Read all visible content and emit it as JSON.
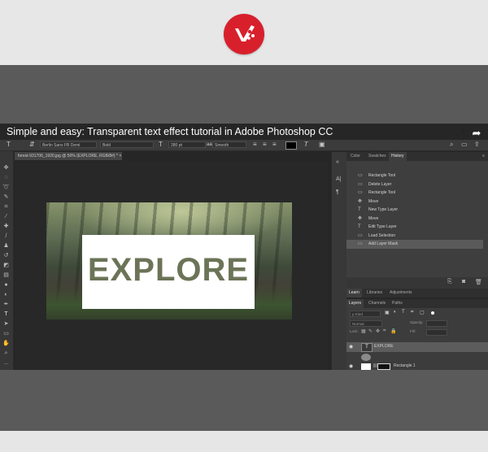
{
  "video": {
    "title": "Simple and easy: Transparent text effect tutorial in Adobe Photoshop CC"
  },
  "options_bar": {
    "font_family": "Berlin Sans FB Demi",
    "font_style": "Bold",
    "font_size": "280 pt",
    "antialias": "Smooth"
  },
  "document": {
    "tab_label": "forest-931706_1920.jpg @ 50% (EXPLORE, RGB/8#) *",
    "tab_close": "×",
    "canvas_text": "EXPLORE"
  },
  "panels": {
    "top_tabs": [
      "Color",
      "Swatches",
      "History"
    ],
    "history_items": [
      {
        "icon": "rect-icon",
        "label": "Rectangle Tool"
      },
      {
        "icon": "rect-icon",
        "label": "Delete Layer"
      },
      {
        "icon": "rect-icon",
        "label": "Rectangle Tool"
      },
      {
        "icon": "move-icon",
        "label": "Move"
      },
      {
        "icon": "type-icon",
        "label": "New Type Layer"
      },
      {
        "icon": "move-icon",
        "label": "Move"
      },
      {
        "icon": "type-icon",
        "label": "Edit Type Layer"
      },
      {
        "icon": "rect-icon",
        "label": "Load Selection"
      },
      {
        "icon": "rect-icon",
        "label": "Add Layer Mask"
      }
    ],
    "lib_tabs": [
      "Learn",
      "Libraries",
      "Adjustments"
    ],
    "layer_tabs": [
      "Layers",
      "Channels",
      "Paths"
    ],
    "layers": {
      "kind_filter": "ρ Kind",
      "blend_mode": "Normal",
      "opacity_label": "Opacity:",
      "lock_label": "Lock:",
      "fill_label": "Fill:",
      "items": [
        {
          "name": "EXPLORE",
          "type_badge": "T"
        },
        {
          "name": "Rectangle 1"
        }
      ]
    }
  },
  "colors": {
    "brand_red": "#d8202c",
    "panel_bg": "#3e3e3e",
    "selected_row": "#5a5a5a"
  }
}
